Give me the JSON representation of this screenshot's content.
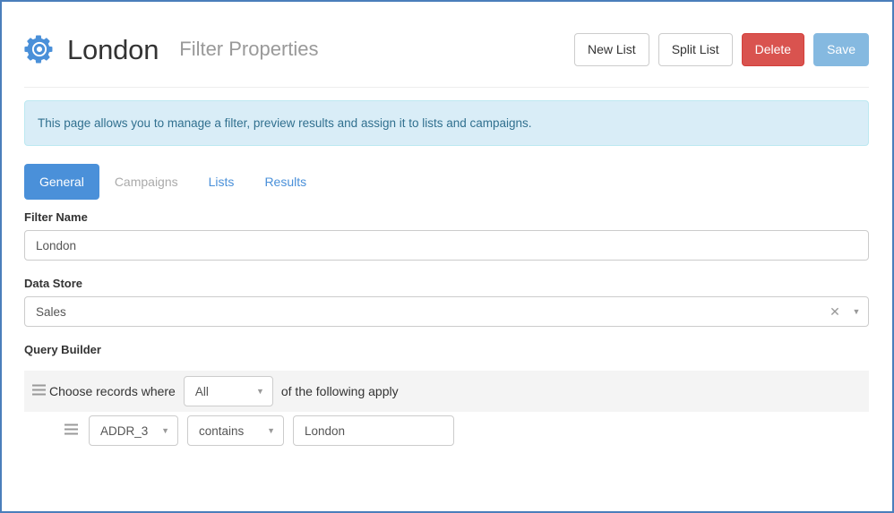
{
  "header": {
    "icon": "gear-icon",
    "title": "London",
    "subtitle": "Filter Properties",
    "buttons": {
      "new_list": "New List",
      "split_list": "Split List",
      "delete": "Delete",
      "save": "Save"
    },
    "colors": {
      "delete_bg": "#d9534f",
      "save_bg": "#85b9e0",
      "accent": "#4a90d9",
      "page_border": "#4a7ebb"
    }
  },
  "alert": {
    "text": "This page allows you to manage a filter, preview results and assign it to lists and campaigns.",
    "bg": "#d9edf7",
    "border": "#bce8f1",
    "text_color": "#31708f"
  },
  "tabs": [
    {
      "label": "General",
      "state": "active"
    },
    {
      "label": "Campaigns",
      "state": "disabled"
    },
    {
      "label": "Lists",
      "state": "link"
    },
    {
      "label": "Results",
      "state": "link"
    }
  ],
  "form": {
    "filter_name": {
      "label": "Filter Name",
      "value": "London",
      "placeholder": ""
    },
    "data_store": {
      "label": "Data Store",
      "value": "Sales",
      "clear_icon": "close-icon",
      "caret_icon": "chevron-down-icon"
    }
  },
  "query_builder": {
    "label": "Query Builder",
    "group": {
      "grip_icon": "drag-handle-icon",
      "text_before": "Choose records where",
      "condition": "All",
      "condition_caret": "chevron-down-icon",
      "text_after": "of the following apply"
    },
    "rules": [
      {
        "grip_icon": "drag-handle-icon",
        "field": "ADDR_3",
        "field_caret": "chevron-down-icon",
        "operator": "contains",
        "operator_caret": "chevron-down-icon",
        "value": "London",
        "value_placeholder": ""
      }
    ],
    "header_bg": "#f4f4f4"
  }
}
